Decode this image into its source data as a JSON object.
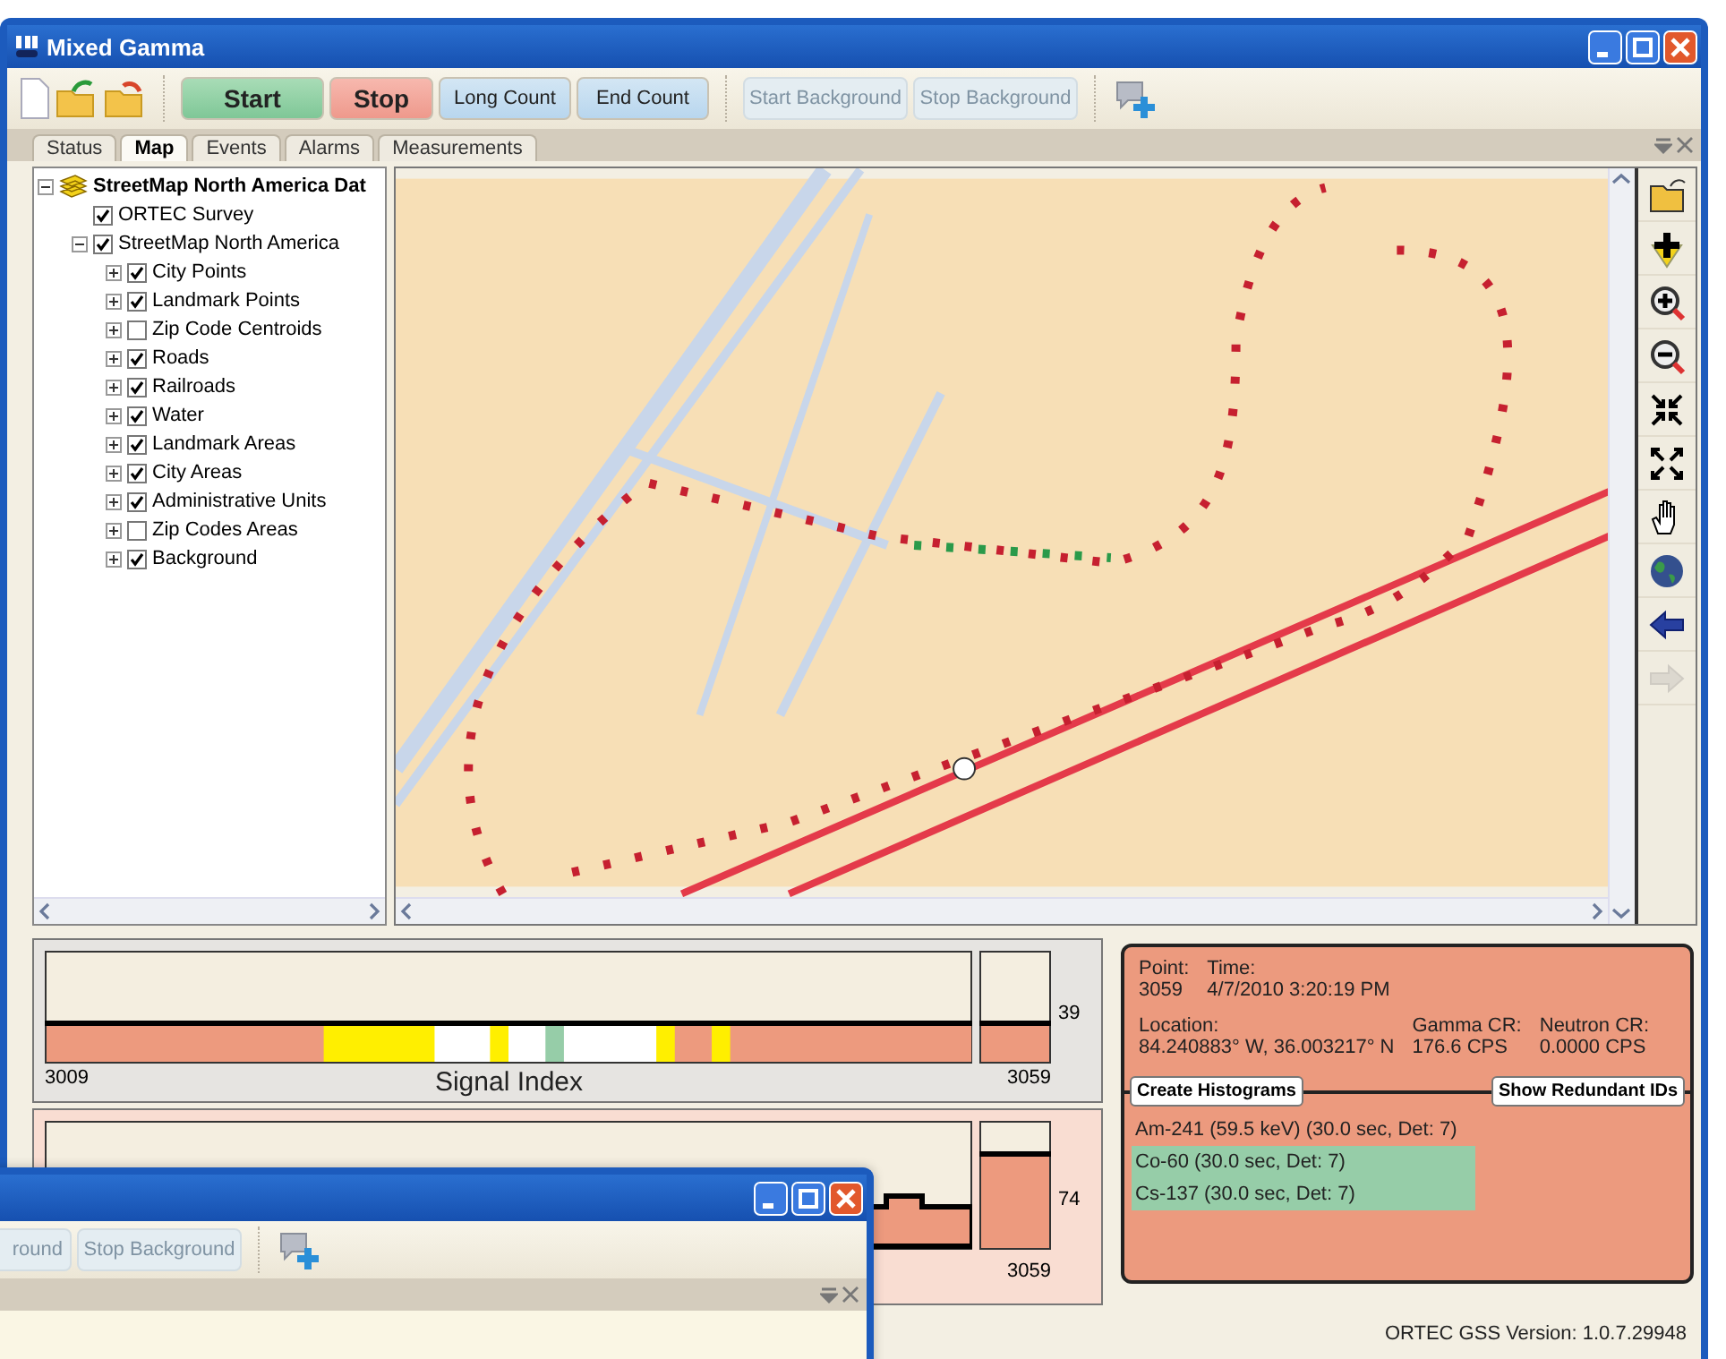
{
  "window": {
    "title": "Mixed Gamma"
  },
  "toolbar": [
    {
      "label": "Start",
      "kind": "start",
      "disabled": false
    },
    {
      "label": "Stop",
      "kind": "stop",
      "disabled": false
    },
    {
      "label": "Long Count",
      "kind": "count",
      "disabled": false
    },
    {
      "label": "End Count",
      "kind": "count",
      "disabled": false
    },
    {
      "label": "Start Background",
      "kind": "count",
      "disabled": true
    },
    {
      "label": "Stop Background",
      "kind": "count",
      "disabled": true
    }
  ],
  "tabs": [
    {
      "label": "Status",
      "selected": false
    },
    {
      "label": "Map",
      "selected": true
    },
    {
      "label": "Events",
      "selected": false
    },
    {
      "label": "Alarms",
      "selected": false
    },
    {
      "label": "Measurements",
      "selected": false
    }
  ],
  "layers": {
    "label": "StreetMap North America Dat",
    "expanded": true,
    "children": [
      {
        "label": "ORTEC Survey",
        "checked": true
      },
      {
        "label": "StreetMap North America",
        "checked": true,
        "expanded": true,
        "children": [
          {
            "label": "City Points",
            "checked": true,
            "expanded": false
          },
          {
            "label": "Landmark Points",
            "checked": true,
            "expanded": false
          },
          {
            "label": "Zip Code Centroids",
            "checked": false,
            "expanded": false
          },
          {
            "label": "Roads",
            "checked": true,
            "expanded": false
          },
          {
            "label": "Railroads",
            "checked": true,
            "expanded": false
          },
          {
            "label": "Water",
            "checked": true,
            "expanded": false
          },
          {
            "label": "Landmark Areas",
            "checked": true,
            "expanded": false
          },
          {
            "label": "City Areas",
            "checked": true,
            "expanded": false
          },
          {
            "label": "Administrative Units",
            "checked": true,
            "expanded": false
          },
          {
            "label": "Zip Codes Areas",
            "checked": false,
            "expanded": false
          },
          {
            "label": "Background",
            "checked": true,
            "expanded": false
          }
        ]
      }
    ]
  },
  "map_tools": [
    {
      "kind": "open",
      "disabled": false
    },
    {
      "kind": "add",
      "disabled": false
    },
    {
      "kind": "zoom_in",
      "disabled": false
    },
    {
      "kind": "zoom_out",
      "disabled": false
    },
    {
      "kind": "shrink",
      "disabled": false
    },
    {
      "kind": "expand",
      "disabled": false
    },
    {
      "kind": "pan",
      "disabled": false
    },
    {
      "kind": "globe",
      "disabled": false
    },
    {
      "kind": "back",
      "disabled": false
    },
    {
      "kind": "forward",
      "disabled": true
    }
  ],
  "signal_strip": {
    "start": "3009",
    "title": "Signal Index",
    "end": "3059",
    "value": "39"
  },
  "histogram": {
    "value": "74",
    "end": "3059"
  },
  "info": {
    "point_label": "Point:",
    "point": "3059",
    "time_label": "Time:",
    "time": "4/7/2010 3:20:19 PM",
    "location_label": "Location:",
    "location": "84.240883° W, 36.003217° N",
    "gamma_label": "Gamma CR:",
    "gamma": "176.6 CPS",
    "neutron_label": "Neutron CR:",
    "neutron": "0.0000 CPS",
    "buttons": [
      "Create Histograms",
      "Show Redundant IDs"
    ],
    "identifications": [
      {
        "label": "Am-241 (59.5 keV) (30.0 sec, Det: 7)",
        "selected": false
      },
      {
        "label": "Co-60 (30.0 sec, Det: 7)",
        "selected": true
      },
      {
        "label": "Cs-137 (30.0 sec, Det: 7)",
        "selected": true
      }
    ]
  },
  "status_bar": "ORTEC GSS Version: 1.0.7.29948",
  "second_window": {
    "toolbar": [
      {
        "label": "round",
        "disabled": true
      },
      {
        "label": "Stop Background",
        "disabled": true
      }
    ]
  }
}
